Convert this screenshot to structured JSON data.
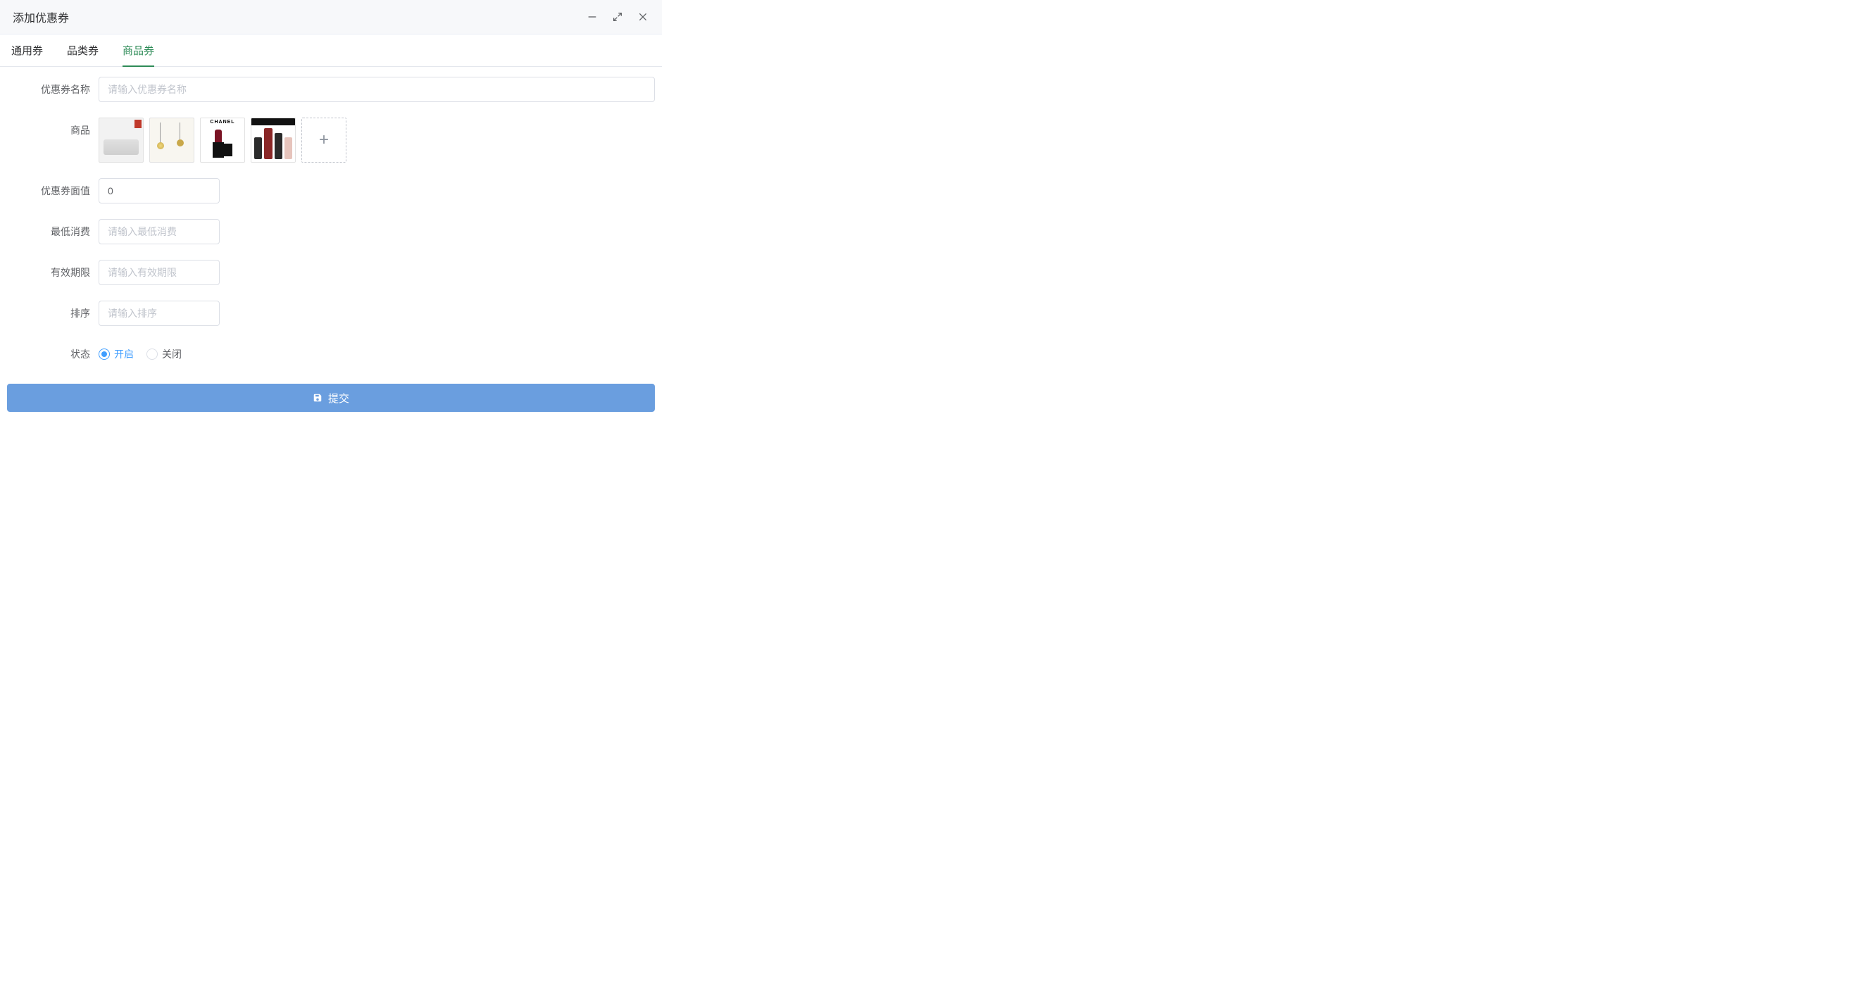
{
  "dialog": {
    "title": "添加优惠券"
  },
  "tabs": [
    {
      "label": "通用券",
      "active": false
    },
    {
      "label": "品类券",
      "active": false
    },
    {
      "label": "商品券",
      "active": true
    }
  ],
  "form": {
    "coupon_name": {
      "label": "优惠券名称",
      "placeholder": "请输入优惠券名称",
      "value": ""
    },
    "products": {
      "label": "商品",
      "items": [
        {
          "name": "sofa",
          "brand_text": ""
        },
        {
          "name": "pendant-lamp",
          "brand_text": ""
        },
        {
          "name": "lipstick",
          "brand_text": "CHANEL"
        },
        {
          "name": "luggage-set",
          "brand_text": ""
        }
      ]
    },
    "face_value": {
      "label": "优惠券面值",
      "value": "0",
      "placeholder": ""
    },
    "min_spend": {
      "label": "最低消费",
      "placeholder": "请输入最低消费",
      "value": ""
    },
    "valid_period": {
      "label": "有效期限",
      "placeholder": "请输入有效期限",
      "value": ""
    },
    "sort": {
      "label": "排序",
      "placeholder": "请输入排序",
      "value": ""
    },
    "status": {
      "label": "状态",
      "options": [
        {
          "label": "开启",
          "value": "on",
          "checked": true
        },
        {
          "label": "关闭",
          "value": "off",
          "checked": false
        }
      ]
    }
  },
  "submit": {
    "label": "提交"
  }
}
